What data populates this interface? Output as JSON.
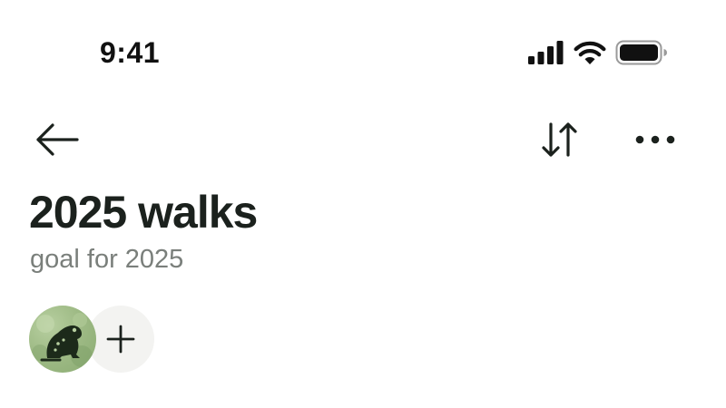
{
  "status_bar": {
    "time": "9:41",
    "icons": [
      "cellular-signal-icon",
      "wifi-icon",
      "battery-icon"
    ]
  },
  "nav": {
    "back_icon": "arrow-left-icon",
    "sort_icon": "sort-arrows-icon",
    "more_icon": "more-horizontal-icon"
  },
  "header": {
    "title": "2025 walks",
    "subtitle": "goal for 2025"
  },
  "members": {
    "avatar_icon": "frog-icon",
    "add_icon": "plus-icon"
  },
  "colors": {
    "text_primary": "#1b211d",
    "text_secondary": "#7a7f7b",
    "avatar_green": "#9fbb86",
    "add_button_bg": "#f3f3f1"
  }
}
